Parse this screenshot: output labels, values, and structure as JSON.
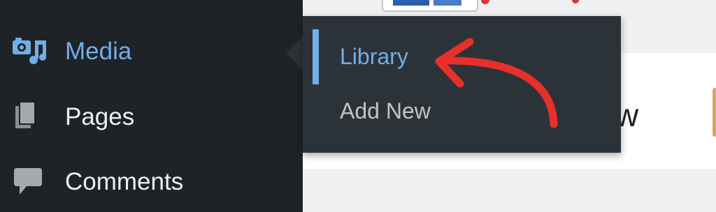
{
  "sidebar": {
    "items": [
      {
        "label": "Media",
        "icon": "media-icon",
        "current": true
      },
      {
        "label": "Pages",
        "icon": "pages-icon",
        "current": false
      },
      {
        "label": "Comments",
        "icon": "comments-icon",
        "current": false
      }
    ]
  },
  "flyout": {
    "items": [
      {
        "label": "Library",
        "current": true
      },
      {
        "label": "Add New",
        "current": false
      }
    ]
  },
  "content": {
    "heading_fragment": "w"
  },
  "annotation": {
    "arrow_icon": "curved-arrow-icon"
  },
  "colors": {
    "sidebar_bg": "#1d2327",
    "flyout_bg": "#2c3338",
    "accent_blue": "#72aee6",
    "arrow_red": "#e8302a",
    "text_light": "#f0f0f1"
  }
}
